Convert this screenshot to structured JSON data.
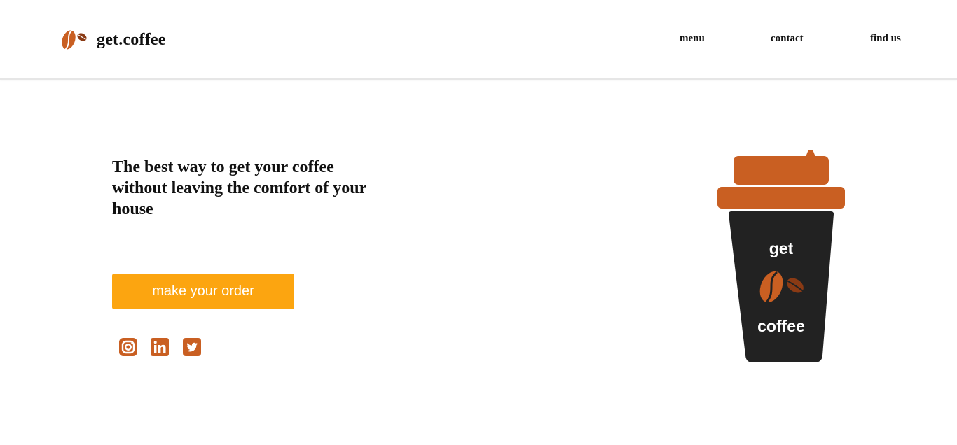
{
  "header": {
    "brand_name": "get.coffee",
    "logo_icon": "coffee-beans-icon",
    "nav": [
      {
        "label": "menu"
      },
      {
        "label": "contact"
      },
      {
        "label": "find us"
      }
    ]
  },
  "hero": {
    "headline": "The best way to get your coffee without leaving the comfort of your house",
    "cta_label": "make your order"
  },
  "social": [
    {
      "icon": "instagram-icon"
    },
    {
      "icon": "linkedin-icon"
    },
    {
      "icon": "twitter-icon"
    }
  ],
  "cup": {
    "text_top": "get",
    "text_bottom": "coffee",
    "icon": "coffee-cup-illustration"
  },
  "colors": {
    "accent_orange": "#c95f22",
    "button_yellow": "#fca510",
    "cup_body": "#222222",
    "bean_dark": "#8a3a14",
    "text": "#111111"
  }
}
